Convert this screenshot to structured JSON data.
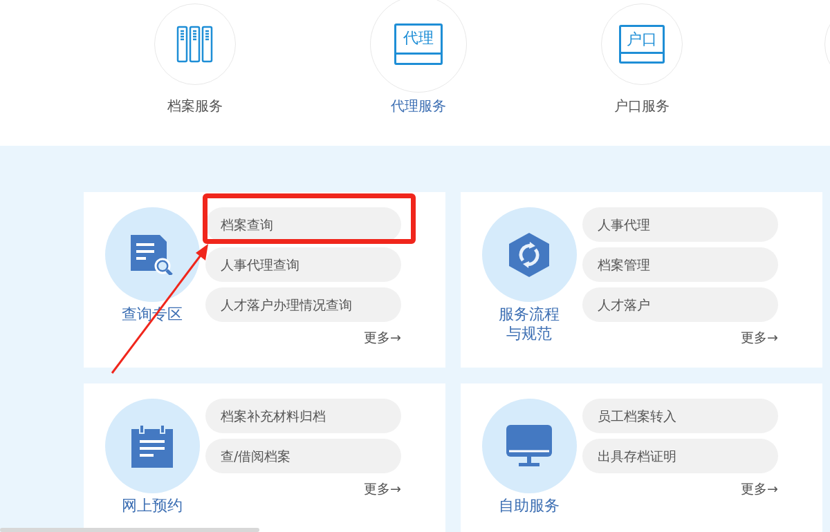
{
  "services": [
    {
      "label": "档案服务",
      "kind": "books",
      "selected": false
    },
    {
      "label": "代理服务",
      "kind": "badge",
      "badge_text": "代理",
      "selected": true
    },
    {
      "label": "户口服务",
      "kind": "badge",
      "badge_text": "户口",
      "selected": false
    },
    {
      "kind": "cut",
      "selected": false
    }
  ],
  "cards": [
    {
      "title": "查询专区",
      "kind": "search",
      "links": [
        {
          "text": "档案查询",
          "highlighted": true
        },
        {
          "text": "人事代理查询",
          "highlighted": false
        },
        {
          "text": "人才落户办理情况查询",
          "highlighted": false
        }
      ],
      "more": "更多→"
    },
    {
      "title": "服务流程与规范",
      "kind": "process",
      "links": [
        {
          "text": "人事代理",
          "highlighted": false
        },
        {
          "text": "档案管理",
          "highlighted": false
        },
        {
          "text": "人才落户",
          "highlighted": false
        }
      ],
      "more": "更多→"
    },
    {
      "title": "网上预约",
      "kind": "booking",
      "links": [
        {
          "text": "档案补充材料归档",
          "highlighted": false
        },
        {
          "text": "查/借阅档案",
          "highlighted": false
        }
      ],
      "more": "更多→"
    },
    {
      "title": "自助服务",
      "kind": "selfservice",
      "links": [
        {
          "text": "员工档案转入",
          "highlighted": false
        },
        {
          "text": "出具存档证明",
          "highlighted": false
        }
      ],
      "more": "更多→"
    }
  ]
}
